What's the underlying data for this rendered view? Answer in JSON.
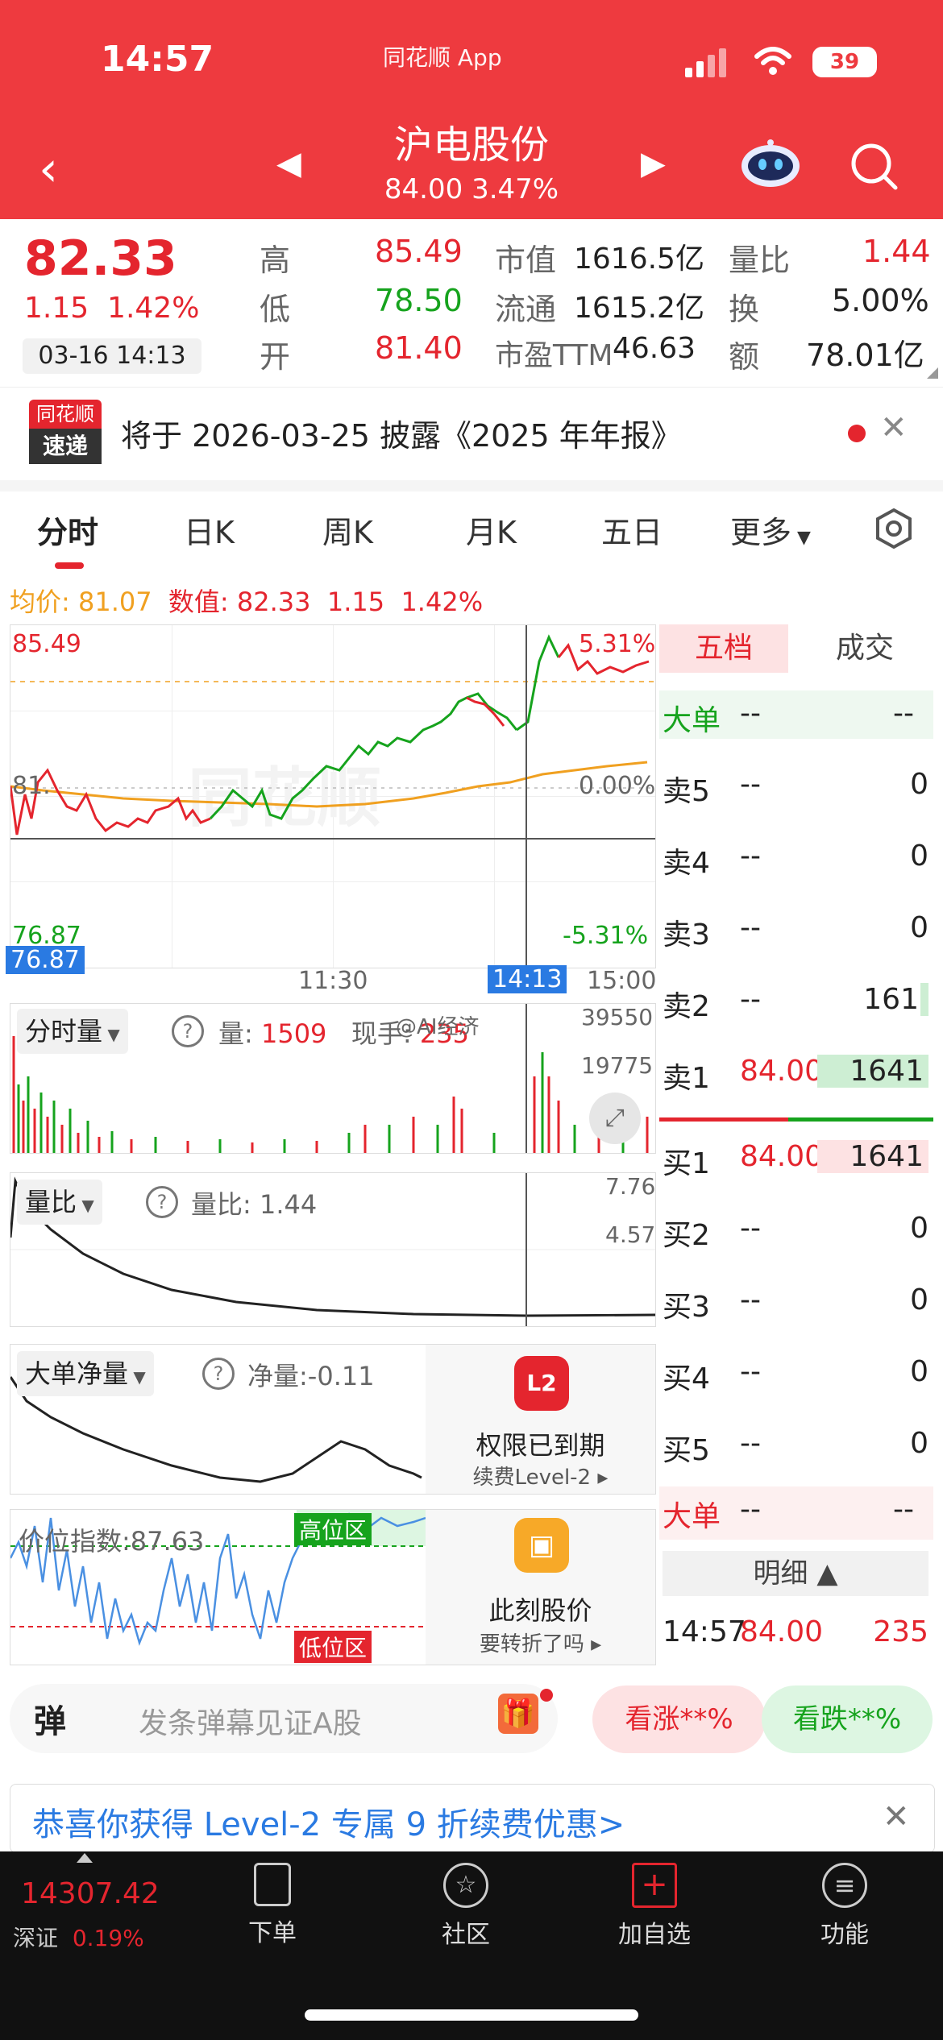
{
  "status_bar": {
    "time": "14:57",
    "app_name": "同花顺 App",
    "battery": "39"
  },
  "header": {
    "title": "沪电股份",
    "subtitle": "84.00  3.47%"
  },
  "quote": {
    "price": "82.33",
    "change": "1.15",
    "change_pct": "1.42%",
    "time": "03-16 14:13",
    "high_label": "高",
    "high": "85.49",
    "low_label": "低",
    "low": "78.50",
    "open_label": "开",
    "open": "81.40",
    "mktcap_label": "市值",
    "mktcap": "1616.5亿",
    "float_label": "流通",
    "float": "1615.2亿",
    "pe_label": "市盈TTM",
    "pe": "46.63",
    "vr_label": "量比",
    "vr": "1.44",
    "turnover_label": "换",
    "turnover": "5.00%",
    "amount_label": "额",
    "amount": "78.01亿"
  },
  "notice": {
    "logo_line1": "同花顺",
    "logo_line2": "速递",
    "text": "将于 2026-03-25 披露《2025 年年报》"
  },
  "tabs": [
    "分时",
    "日K",
    "周K",
    "月K",
    "五日",
    "更多"
  ],
  "info_line": {
    "avg_label": "均价:",
    "avg": "81.07",
    "val_label": "数值:",
    "val": "82.33",
    "chg": "1.15",
    "pct": "1.42%"
  },
  "main_chart": {
    "y_top": "85.49",
    "y_mid": "81.",
    "y_bottom": "76.87",
    "cursor_price": "76.87",
    "pct_top": "5.31%",
    "pct_mid": "0.00%",
    "pct_bottom": "-5.31%",
    "x_mid": "11:30",
    "x_cursor": "14:13",
    "x_end": "15:00",
    "watermark": "同花顺"
  },
  "volume_panel": {
    "selector": "分时量",
    "vol_label": "量:",
    "vol": "1509",
    "cur_label": "现手:",
    "cur": "235",
    "y1": "39550",
    "y2": "19775",
    "weibo": "@AI经济"
  },
  "ratio_panel": {
    "selector": "量比",
    "label": "量比:",
    "value": "1.44",
    "y1": "7.76",
    "y2": "4.57"
  },
  "bignet_panel": {
    "selector": "大单净量",
    "label": "净量:",
    "value": "-0.11",
    "lock_title": "权限已到期",
    "lock_sub": "续费Level-2",
    "lock_icon": "L2"
  },
  "price_index_panel": {
    "label": "价位指数:",
    "value": "87.63",
    "high_zone": "高位区",
    "low_zone": "低位区",
    "lock_title": "此刻股价",
    "lock_sub": "要转折了吗"
  },
  "order_book": {
    "tab_active": "五档",
    "tab_other": "成交",
    "big_label": "大单",
    "dash": "--",
    "sells": [
      {
        "label": "卖5",
        "price": "--",
        "vol": "0"
      },
      {
        "label": "卖4",
        "price": "--",
        "vol": "0"
      },
      {
        "label": "卖3",
        "price": "--",
        "vol": "0"
      },
      {
        "label": "卖2",
        "price": "--",
        "vol": "161"
      },
      {
        "label": "卖1",
        "price": "84.00",
        "vol": "1641"
      }
    ],
    "buys": [
      {
        "label": "买1",
        "price": "84.00",
        "vol": "1641"
      },
      {
        "label": "买2",
        "price": "--",
        "vol": "0"
      },
      {
        "label": "买3",
        "price": "--",
        "vol": "0"
      },
      {
        "label": "买4",
        "price": "--",
        "vol": "0"
      },
      {
        "label": "买5",
        "price": "--",
        "vol": "0"
      }
    ],
    "detail_label": "明细",
    "last_trade": {
      "time": "14:57",
      "price": "84.00",
      "vol": "235"
    }
  },
  "danmu": {
    "badge": "弹",
    "placeholder": "发条弹幕见证A股",
    "up": "看涨**%",
    "down": "看跌**%"
  },
  "banner": {
    "text": "恭喜你获得 Level-2 专属 9 折续费优惠>"
  },
  "bottom_bar": {
    "index_value": "14307.42",
    "index_name": "深证",
    "index_pct": "0.19%",
    "items": [
      "下单",
      "社区",
      "加自选",
      "功能"
    ]
  },
  "colors": {
    "header": "#ee3a3f",
    "up": "#e4252e",
    "down": "#16a31d",
    "avg_line": "#f0a020"
  }
}
